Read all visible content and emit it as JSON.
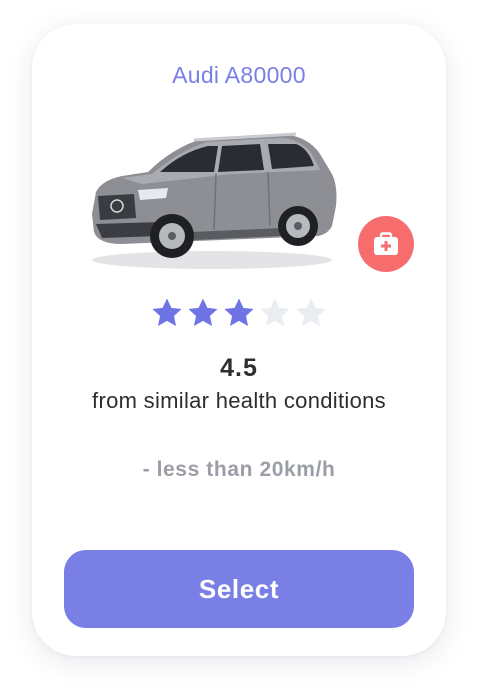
{
  "card": {
    "title": "Audi A80000",
    "image_icon": "car-image",
    "badge_icon": "first-aid-kit-icon",
    "rating": {
      "stars_filled": 3,
      "stars_total": 5,
      "value": "4.5",
      "caption": "from similar health conditions"
    },
    "speed_note": "- less than 20km/h",
    "select_label": "Select"
  },
  "colors": {
    "accent": "#7a7fe6",
    "star_filled": "#6f74e4",
    "star_empty": "#e9ecf1",
    "badge": "#f76d6d",
    "muted_text": "#9b9ea6",
    "body_text": "#2e2e2e"
  }
}
